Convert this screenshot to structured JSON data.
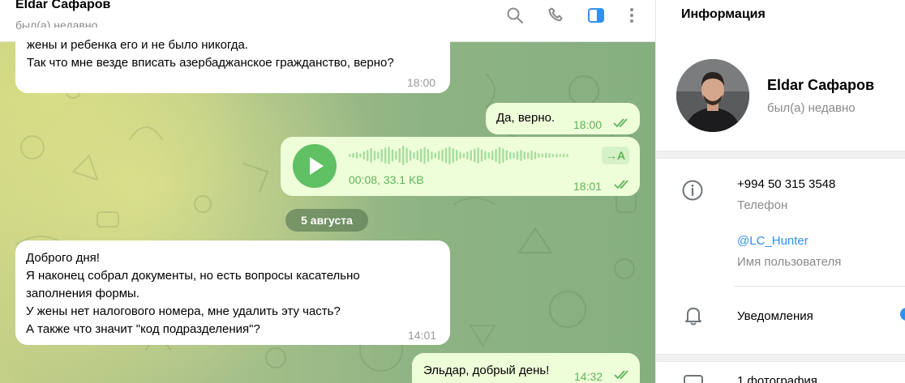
{
  "chat_header": {
    "name": "Eldar Сафаров",
    "status": "был(а) недавно",
    "icons": [
      "search-icon",
      "phone-icon",
      "sidebar-toggle-icon",
      "more-vertical-icon"
    ]
  },
  "messages": {
    "m1": {
      "lines": [
        "жены и ребенка его и не было никогда.",
        "Так что мне везде вписать азербаджанское гражданство, верно?"
      ],
      "time": "18:00"
    },
    "m2": {
      "text": "Да, верно.",
      "time": "18:00"
    },
    "voice": {
      "meta": "00:08, 33.1 KB",
      "time": "18:01",
      "transcribe_label": "→A"
    },
    "date_separator": "5 августа",
    "m3": {
      "lines": [
        "Доброго дня!",
        "Я наконец собрал документы, но есть вопросы касательно",
        "заполнения формы.",
        "У жены нет налогового номера, мне удалить эту часть?",
        "А также что значит \"код подразделения\"?"
      ],
      "time": "14:01"
    },
    "m4": {
      "text": "Эльдар, добрый день!",
      "time": "14:32"
    }
  },
  "info_panel": {
    "title": "Информация",
    "name": "Eldar Сафаров",
    "status": "был(а) недавно",
    "phone": "+994 50 315 3548",
    "phone_label": "Телефон",
    "username": "@LC_Hunter",
    "username_label": "Имя пользователя",
    "notifications_label": "Уведомления",
    "photos_label": "1 фотография"
  },
  "colors": {
    "accent": "#3390ec",
    "outgoing_bubble": "#eefed9",
    "outgoing_meta": "#5fb35b",
    "play_button": "#5fc064"
  }
}
